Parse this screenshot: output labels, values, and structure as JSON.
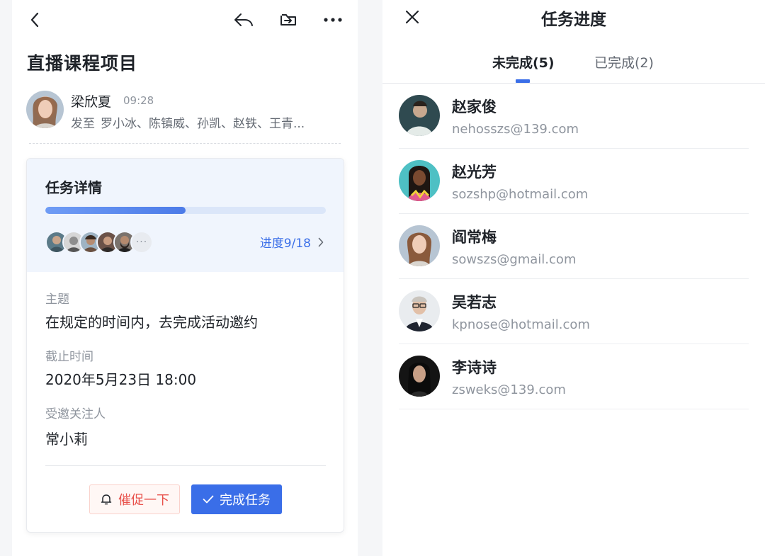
{
  "detail": {
    "title": "直播课程项目",
    "sender": {
      "name": "梁欣夏",
      "time": "09:28",
      "to_label": "发至",
      "recipients": "罗小冰、陈镇威、孙凯、赵铁、王青..."
    },
    "task": {
      "heading": "任务详情",
      "progress_fraction": 0.5,
      "progress_label": "进度9/18",
      "more_symbol": "···",
      "subject_label": "主题",
      "subject": "在规定的时间内，去完成活动邀约",
      "deadline_label": "截止时间",
      "deadline": "2020年5月23日 18:00",
      "watcher_label": "受邀关注人",
      "watcher": "常小莉",
      "remind_label": "催促一下",
      "complete_label": "完成任务"
    },
    "icons": [
      "back-icon",
      "reply-icon",
      "move-to-folder-icon",
      "more-icon",
      "bell-icon",
      "check-icon",
      "chevron-right-icon"
    ]
  },
  "progress_panel": {
    "title": "任务进度",
    "tabs": [
      {
        "label": "未完成(5)",
        "active": true
      },
      {
        "label": "已完成(2)",
        "active": false
      }
    ],
    "members": [
      {
        "name": "赵家俊",
        "email": "nehosszs@139.com"
      },
      {
        "name": "赵光芳",
        "email": "sozshp@hotmail.com"
      },
      {
        "name": "阎常梅",
        "email": "sowszs@gmail.com"
      },
      {
        "name": "吴若志",
        "email": "kpnose@hotmail.com"
      },
      {
        "name": "李诗诗",
        "email": "zsweks@139.com"
      }
    ]
  },
  "colors": {
    "accent": "#3a6ee8",
    "danger": "#e8504a",
    "card_head_bg": "#f0f5fd",
    "text_primary": "#1f2329",
    "text_secondary": "#8f959e"
  }
}
